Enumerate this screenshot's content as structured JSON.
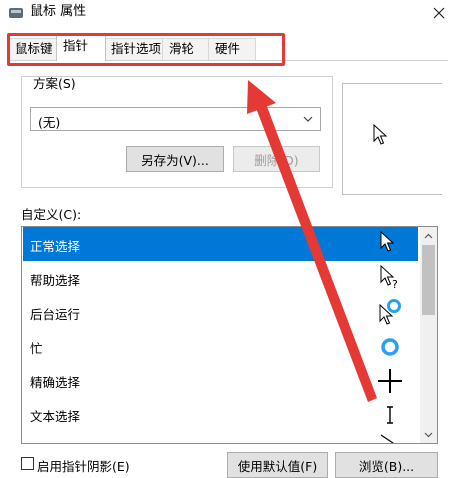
{
  "window": {
    "title": "鼠标 属性"
  },
  "tabs": [
    "鼠标键",
    "指针",
    "指针选项",
    "滑轮",
    "硬件"
  ],
  "active_tab": "指针",
  "scheme": {
    "label": "方案(S)",
    "selected": "(无)",
    "save_as_label": "另存为(V)...",
    "delete_label": "删除(D)"
  },
  "custom": {
    "label": "自定义(C):",
    "items": [
      {
        "label": "正常选择",
        "icon": "normal-select-cursor-icon"
      },
      {
        "label": "帮助选择",
        "icon": "help-select-cursor-icon"
      },
      {
        "label": "后台运行",
        "icon": "working-in-background-cursor-icon"
      },
      {
        "label": "忙",
        "icon": "busy-cursor-icon"
      },
      {
        "label": "精确选择",
        "icon": "precision-select-cursor-icon"
      },
      {
        "label": "文本选择",
        "icon": "text-select-cursor-icon"
      }
    ]
  },
  "bottom": {
    "shadow_label": "启用指针阴影(E)",
    "use_default_label": "使用默认值(F)",
    "browse_label": "浏览(B)..."
  },
  "colors": {
    "selection": "#0078d7",
    "annotation": "#e53935",
    "busy_ring": "#2aa0f0"
  }
}
